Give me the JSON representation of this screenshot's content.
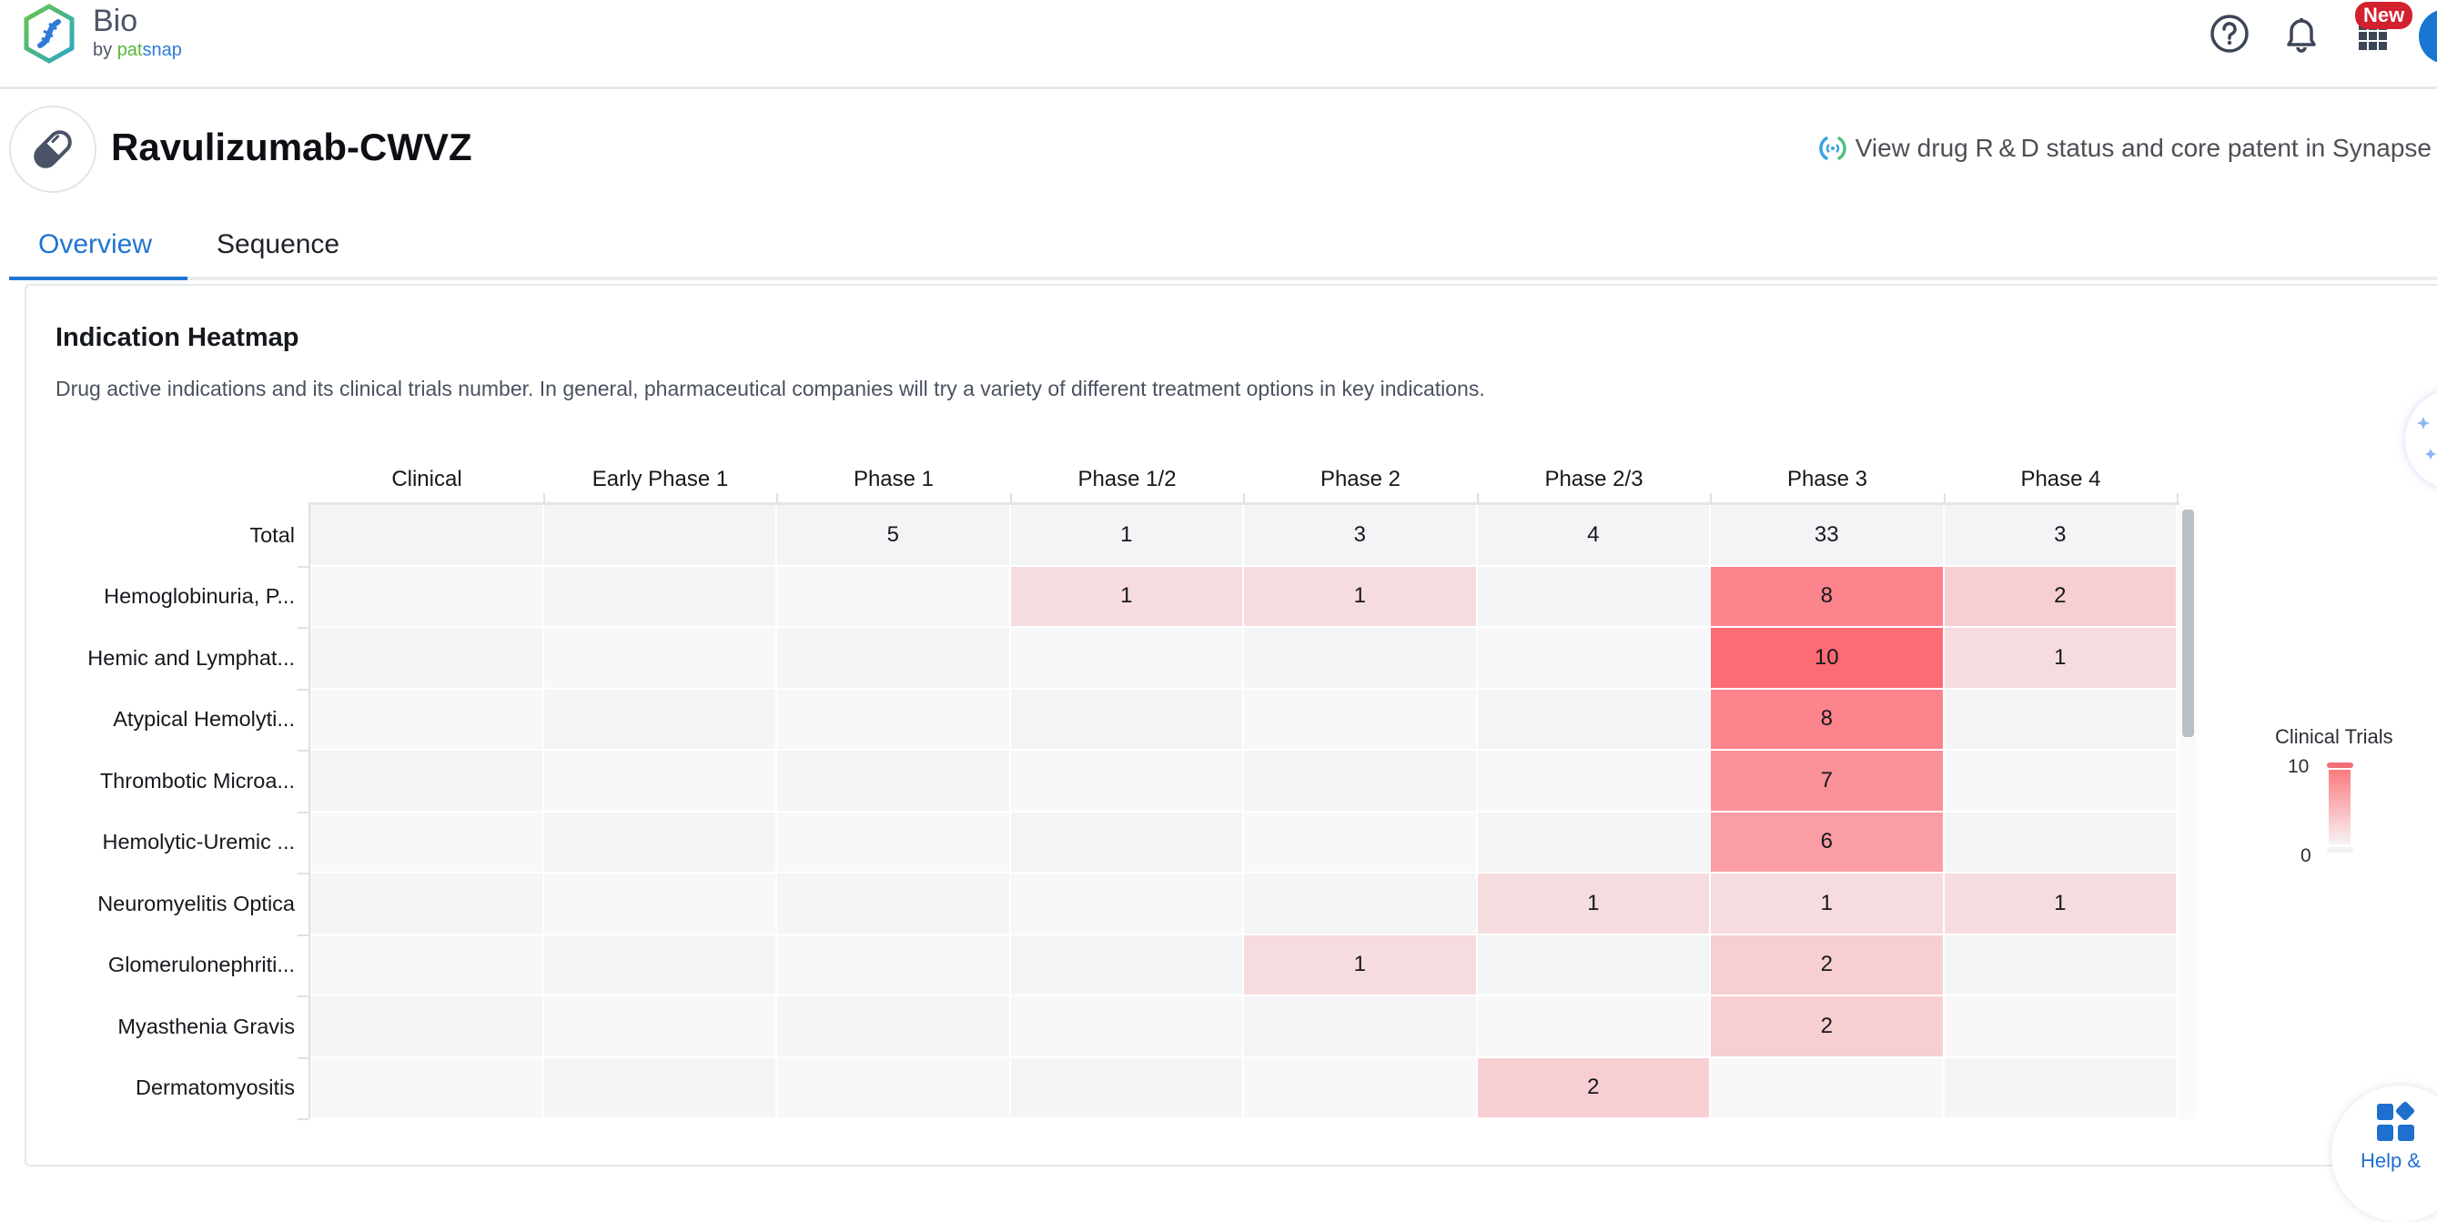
{
  "header": {
    "brand_name": "Bio",
    "brand_by": "by ",
    "brand_pat": "pat",
    "brand_snap": "snap",
    "icons": [
      "help-icon",
      "bell-icon",
      "apps-grid-icon"
    ],
    "new_badge": "New"
  },
  "drug": {
    "title": "Ravulizumab-CWVZ",
    "icon": "pill-icon",
    "synapse_link": "View drug R & D status and core patent in Synapse"
  },
  "tabs": [
    {
      "label": "Overview",
      "active": true
    },
    {
      "label": "Sequence",
      "active": false
    }
  ],
  "card": {
    "title": "Indication Heatmap",
    "description": "Drug active indications and its clinical trials number. In general, pharmaceutical companies will try a variety of different treatment options in key indications."
  },
  "help_widget": {
    "label": "Help &"
  },
  "colors": {
    "accent": "#1f74d1",
    "heat_max": "#fd6b75",
    "heat_min": "#f6e8eb",
    "empty_even": "#f4f5f7",
    "empty_odd": "#f8f8fa"
  },
  "chart_data": {
    "type": "heatmap",
    "title": "Indication Heatmap",
    "columns": [
      "Clinical",
      "Early Phase 1",
      "Phase 1",
      "Phase 1/2",
      "Phase 2",
      "Phase 2/3",
      "Phase 3",
      "Phase 4"
    ],
    "total_row": {
      "label": "Total",
      "values": [
        null,
        null,
        5,
        1,
        3,
        4,
        33,
        3
      ]
    },
    "rows": [
      {
        "label": "Hemoglobinuria, P...",
        "values": [
          null,
          null,
          null,
          1,
          1,
          null,
          8,
          2
        ]
      },
      {
        "label": "Hemic and Lymphat...",
        "values": [
          null,
          null,
          null,
          null,
          null,
          null,
          10,
          1
        ]
      },
      {
        "label": "Atypical Hemolyti...",
        "values": [
          null,
          null,
          null,
          null,
          null,
          null,
          8,
          null
        ]
      },
      {
        "label": "Thrombotic Microa...",
        "values": [
          null,
          null,
          null,
          null,
          null,
          null,
          7,
          null
        ]
      },
      {
        "label": "Hemolytic-Uremic ...",
        "values": [
          null,
          null,
          null,
          null,
          null,
          null,
          6,
          null
        ]
      },
      {
        "label": "Neuromyelitis Optica",
        "values": [
          null,
          null,
          null,
          null,
          null,
          1,
          1,
          1
        ]
      },
      {
        "label": "Glomerulonephriti...",
        "values": [
          null,
          null,
          null,
          null,
          1,
          null,
          2,
          null
        ]
      },
      {
        "label": "Myasthenia Gravis",
        "values": [
          null,
          null,
          null,
          null,
          null,
          null,
          2,
          null
        ]
      },
      {
        "label": "Dermatomyositis",
        "values": [
          null,
          null,
          null,
          null,
          null,
          2,
          null,
          null
        ]
      }
    ],
    "legend": {
      "title": "Clinical Trials",
      "max_label": "10",
      "min_label": "0",
      "range": [
        0,
        10
      ],
      "placement": "right"
    }
  }
}
